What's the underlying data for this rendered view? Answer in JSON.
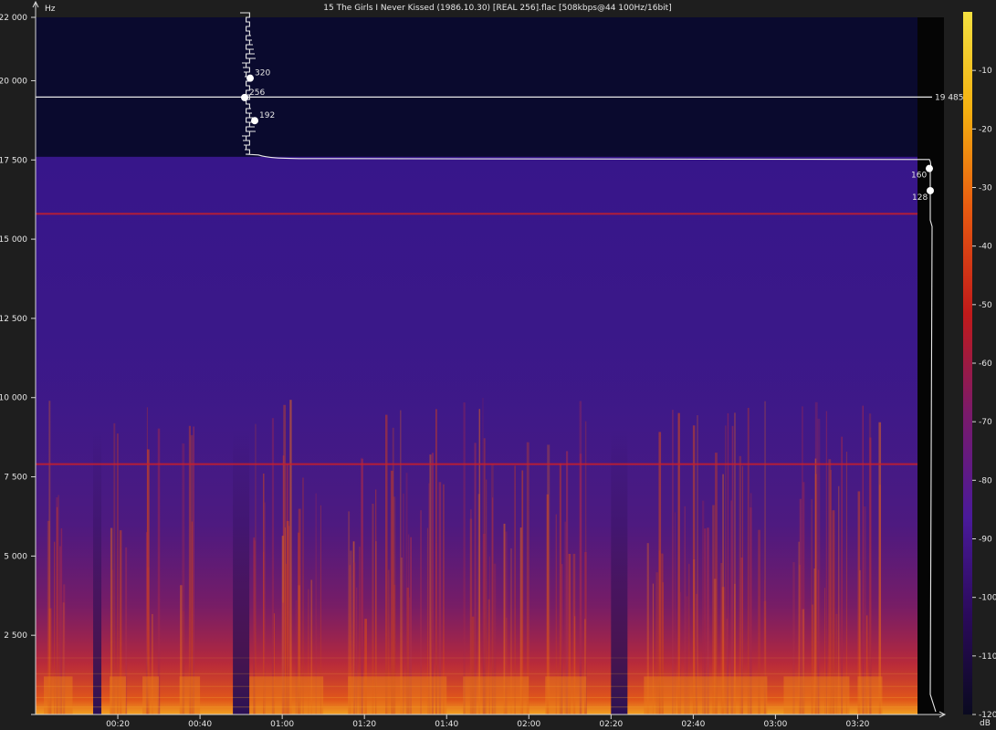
{
  "chart_data": {
    "type": "heatmap",
    "title": "15 The Girls I Never Kissed (1986.10.30) [REAL 256].flac [508kbps@44 100Hz/16bit]",
    "ylabel": "Hz",
    "xlim": [
      0,
      221
    ],
    "ylim": [
      0,
      22000
    ],
    "x_ticks": [
      20,
      40,
      60,
      80,
      100,
      120,
      140,
      160,
      180,
      200
    ],
    "x_tick_labels": [
      "00:20",
      "00:40",
      "01:00",
      "01:20",
      "01:40",
      "02:00",
      "02:20",
      "02:40",
      "03:00",
      "03:20"
    ],
    "y_ticks": [
      2500,
      5000,
      7500,
      10000,
      12500,
      15000,
      17500,
      20000,
      22000
    ],
    "y_tick_labels": [
      "2 500",
      "5 000",
      "7 500",
      "10 000",
      "12 500",
      "15 000",
      "17 500",
      "20 000",
      "22 000"
    ],
    "colorbar": {
      "label": "dB",
      "range": [
        -120,
        0
      ],
      "ticks": [
        -10,
        -20,
        -30,
        -40,
        -50,
        -60,
        -70,
        -80,
        -90,
        -100,
        -110,
        -120
      ],
      "tick_labels": [
        "-10",
        "-20",
        "-30",
        "-40",
        "-50",
        "-60",
        "-70",
        "-80",
        "-90",
        "-100",
        "-110",
        "-120"
      ],
      "colors": [
        "#0a0a20",
        "#2a0a5a",
        "#4a1a9a",
        "#7a1a6a",
        "#c01a1a",
        "#e85a10",
        "#f4b010",
        "#f4e040"
      ]
    },
    "cutoff_hz": 17600,
    "reference_line": {
      "value": 19485,
      "label": "19 485"
    },
    "steady_tones_hz": [
      15800,
      7900
    ],
    "loud_sections": [
      [
        2,
        9
      ],
      [
        18,
        22
      ],
      [
        26,
        30
      ],
      [
        35,
        40
      ],
      [
        52,
        70
      ],
      [
        76,
        100
      ],
      [
        104,
        120
      ],
      [
        124,
        134
      ],
      [
        148,
        178
      ],
      [
        182,
        198
      ],
      [
        200,
        206
      ]
    ],
    "quiet_sections": [
      [
        14,
        16
      ],
      [
        48,
        52
      ],
      [
        140,
        144
      ]
    ],
    "bitrate_curve_left": [
      {
        "label": "320",
        "hz": 20080
      },
      {
        "label": "256",
        "hz": 19470
      },
      {
        "label": "192",
        "hz": 18740
      }
    ],
    "bitrate_curve_right": [
      {
        "label": "160",
        "hz": 17230
      },
      {
        "label": "128",
        "hz": 16530
      }
    ]
  }
}
